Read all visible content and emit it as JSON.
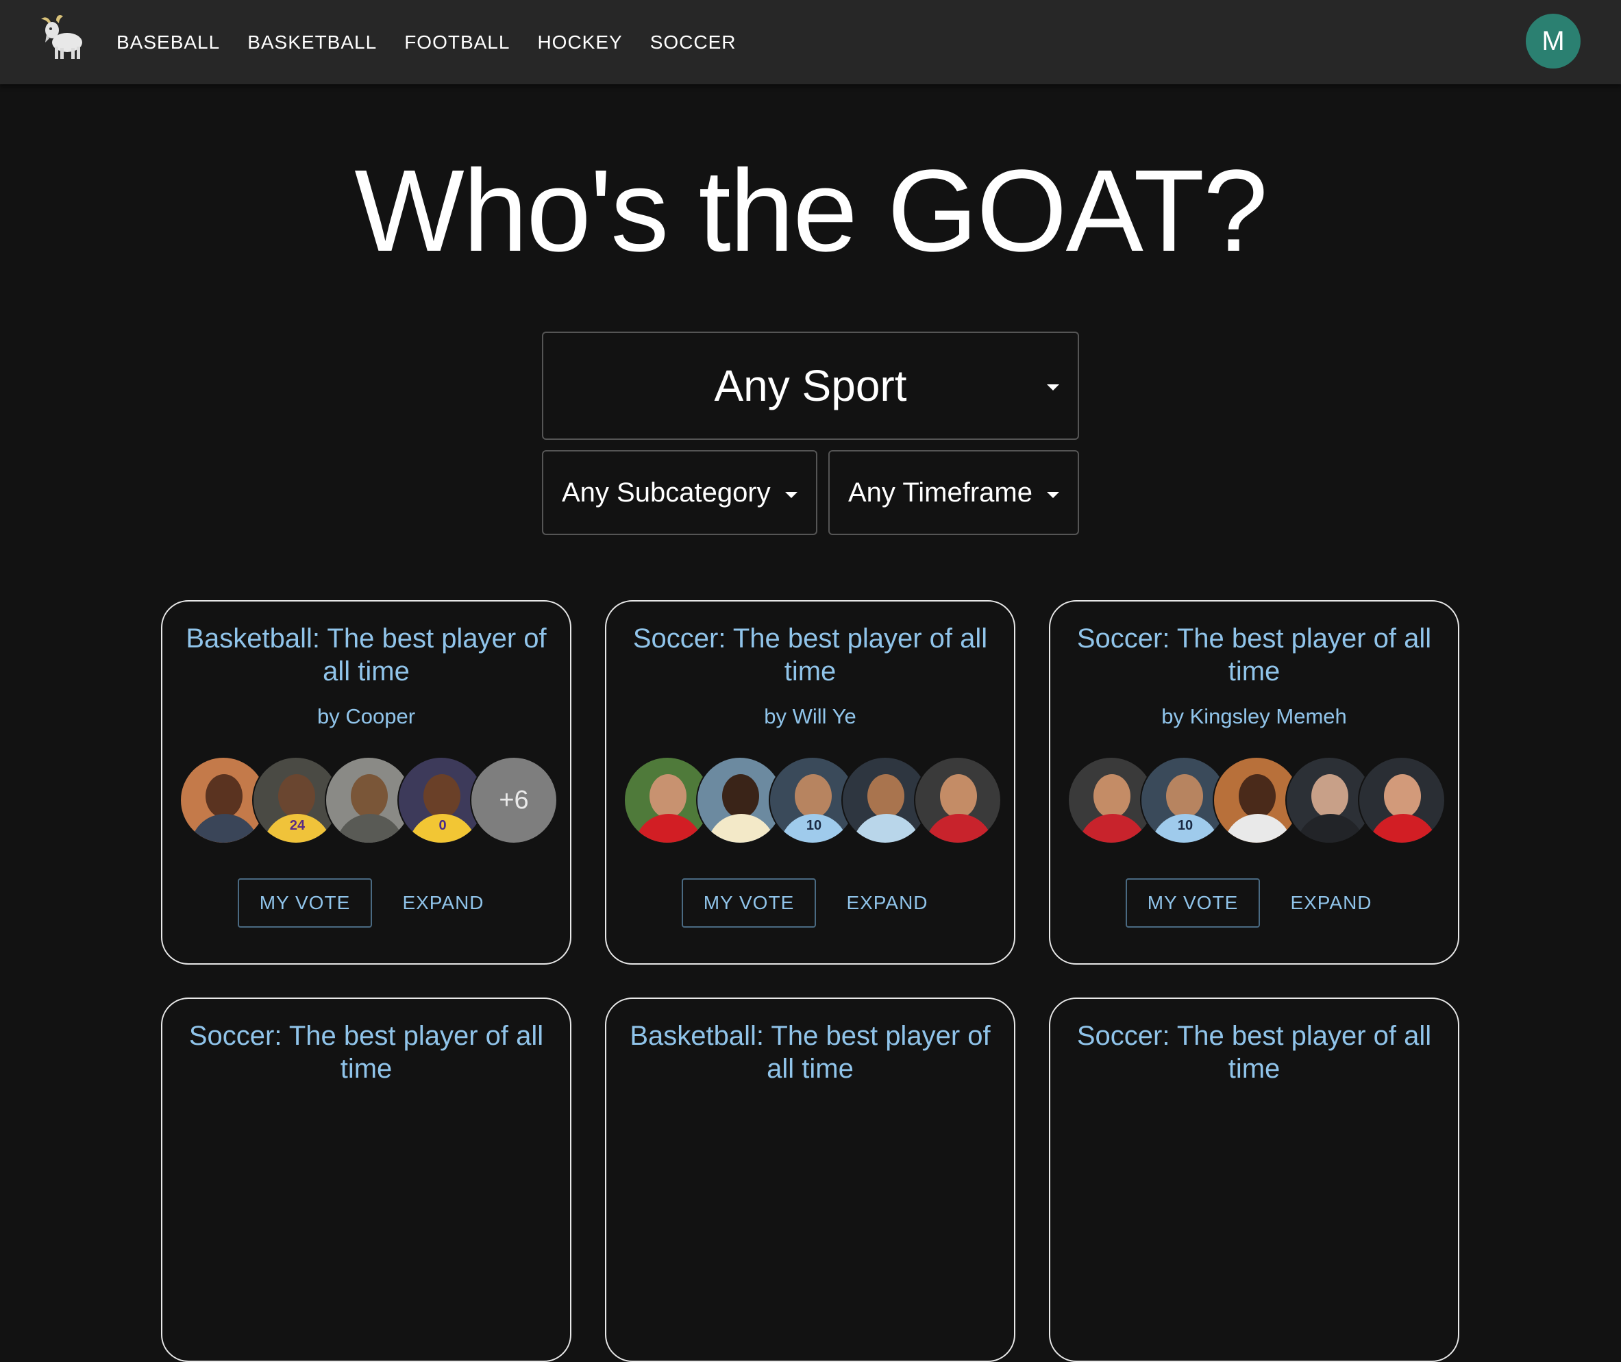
{
  "nav": {
    "logo": "goat-logo",
    "items": [
      "BASEBALL",
      "BASKETBALL",
      "FOOTBALL",
      "HOCKEY",
      "SOCCER"
    ],
    "avatar_initial": "M"
  },
  "hero": {
    "title": "Who's the GOAT?"
  },
  "filters": {
    "sport": "Any Sport",
    "subcategory": "Any Subcategory",
    "timeframe": "Any Timeframe"
  },
  "colors": {
    "background": "#121212",
    "topbar": "#272727",
    "link": "#90c4ea",
    "avatar": "#2b8071"
  },
  "cards": [
    {
      "title": "Basketball: The best player of all time",
      "author": "by Cooper",
      "more": "+6",
      "vote_label": "MY VOTE",
      "expand_label": "EXPAND"
    },
    {
      "title": "Soccer: The best player of all time",
      "author": "by Will Ye",
      "vote_label": "MY VOTE",
      "expand_label": "EXPAND"
    },
    {
      "title": "Soccer: The best player of all time",
      "author": "by Kingsley Memeh",
      "vote_label": "MY VOTE",
      "expand_label": "EXPAND"
    },
    {
      "title": "Soccer: The best player of all time"
    },
    {
      "title": "Basketball: The best player of all time"
    },
    {
      "title": "Soccer: The best player of all time"
    }
  ]
}
